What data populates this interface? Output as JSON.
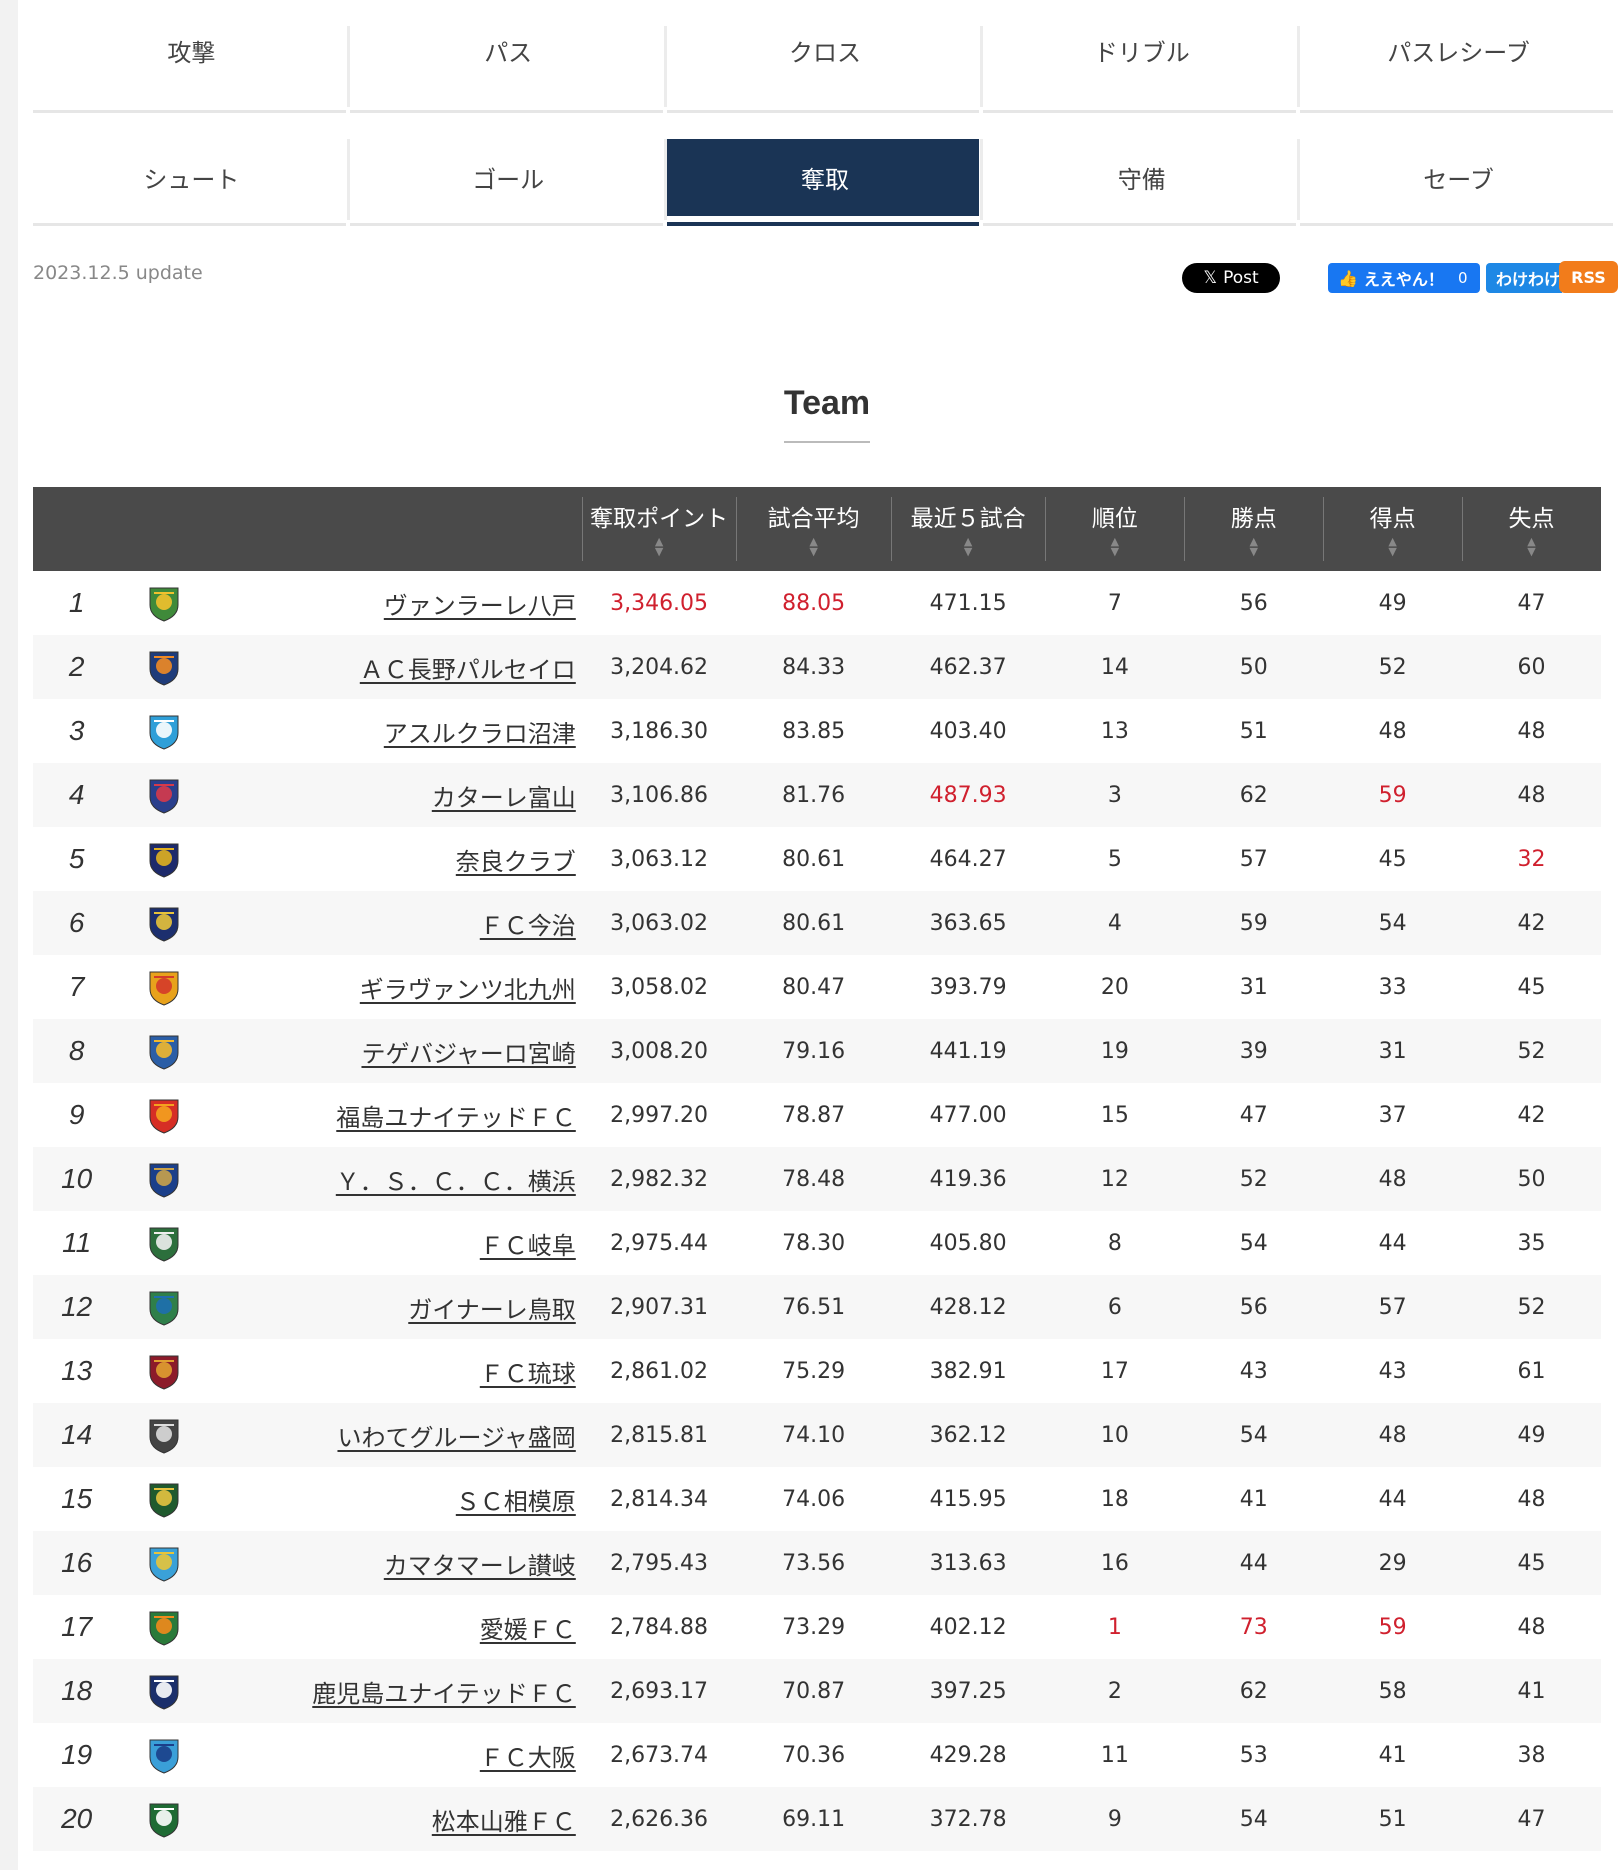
{
  "tabs_row1": [
    "攻撃",
    "パス",
    "クロス",
    "ドリブル",
    "パスレシーブ"
  ],
  "tabs_row2": [
    "シュート",
    "ゴール",
    "奪取",
    "守備",
    "セーブ"
  ],
  "active_tab": "奪取",
  "update_text": "2023.12.5 update",
  "share": {
    "x_label": "Post",
    "fb_label": "ええやん！",
    "fb_count": "0",
    "hatena_label": "わけわけ",
    "rss_label": "RSS"
  },
  "section_title": "Team",
  "table": {
    "headers": [
      "奪取ポイント",
      "試合平均",
      "最近５試合",
      "順位",
      "勝点",
      "得点",
      "失点"
    ],
    "rows": [
      {
        "rank": "1",
        "team": "ヴァンラーレ八戸",
        "points": "3,346.05",
        "avg": "88.05",
        "last5": "471.15",
        "pos": "7",
        "pts": "56",
        "gf": "49",
        "ga": "47",
        "crest_color": "#3f8a3a",
        "crest_accent": "#f2c12e"
      },
      {
        "rank": "2",
        "team": "ＡＣ長野パルセイロ",
        "points": "3,204.62",
        "avg": "84.33",
        "last5": "462.37",
        "pos": "14",
        "pts": "50",
        "gf": "52",
        "ga": "60",
        "crest_color": "#1f3c7a",
        "crest_accent": "#f08a24"
      },
      {
        "rank": "3",
        "team": "アスルクラロ沼津",
        "points": "3,186.30",
        "avg": "83.85",
        "last5": "403.40",
        "pos": "13",
        "pts": "51",
        "gf": "48",
        "ga": "48",
        "crest_color": "#2f9fd8",
        "crest_accent": "#ffffff"
      },
      {
        "rank": "4",
        "team": "カターレ富山",
        "points": "3,106.86",
        "avg": "81.76",
        "last5": "487.93",
        "pos": "3",
        "pts": "62",
        "gf": "59",
        "ga": "48",
        "crest_color": "#2a3f8c",
        "crest_accent": "#d63a4a"
      },
      {
        "rank": "5",
        "team": "奈良クラブ",
        "points": "3,063.12",
        "avg": "80.61",
        "last5": "464.27",
        "pos": "5",
        "pts": "57",
        "gf": "45",
        "ga": "32",
        "crest_color": "#1d2a6b",
        "crest_accent": "#e0b020"
      },
      {
        "rank": "6",
        "team": "ＦＣ今治",
        "points": "3,063.02",
        "avg": "80.61",
        "last5": "363.65",
        "pos": "4",
        "pts": "59",
        "gf": "54",
        "ga": "42",
        "crest_color": "#1c2f6e",
        "crest_accent": "#e8c33a"
      },
      {
        "rank": "7",
        "team": "ギラヴァンツ北九州",
        "points": "3,058.02",
        "avg": "80.47",
        "last5": "393.79",
        "pos": "20",
        "pts": "31",
        "gf": "33",
        "ga": "45",
        "crest_color": "#e8a21c",
        "crest_accent": "#d43a2a"
      },
      {
        "rank": "8",
        "team": "テゲバジャーロ宮崎",
        "points": "3,008.20",
        "avg": "79.16",
        "last5": "441.19",
        "pos": "19",
        "pts": "39",
        "gf": "31",
        "ga": "52",
        "crest_color": "#2b5ea6",
        "crest_accent": "#f1b82d"
      },
      {
        "rank": "9",
        "team": "福島ユナイテッドＦＣ",
        "points": "2,997.20",
        "avg": "78.87",
        "last5": "477.00",
        "pos": "15",
        "pts": "47",
        "gf": "37",
        "ga": "42",
        "crest_color": "#d62e25",
        "crest_accent": "#f4a21f"
      },
      {
        "rank": "10",
        "team": "Ｙ．Ｓ．Ｃ．Ｃ．横浜",
        "points": "2,982.32",
        "avg": "78.48",
        "last5": "419.36",
        "pos": "12",
        "pts": "52",
        "gf": "48",
        "ga": "50",
        "crest_color": "#1b3f8a",
        "crest_accent": "#c9a24a"
      },
      {
        "rank": "11",
        "team": "ＦＣ岐阜",
        "points": "2,975.44",
        "avg": "78.30",
        "last5": "405.80",
        "pos": "8",
        "pts": "54",
        "gf": "44",
        "ga": "35",
        "crest_color": "#2c6f3c",
        "crest_accent": "#eeeeee"
      },
      {
        "rank": "12",
        "team": "ガイナーレ鳥取",
        "points": "2,907.31",
        "avg": "76.51",
        "last5": "428.12",
        "pos": "6",
        "pts": "56",
        "gf": "57",
        "ga": "52",
        "crest_color": "#2f7f4a",
        "crest_accent": "#1e6fb0"
      },
      {
        "rank": "13",
        "team": "ＦＣ琉球",
        "points": "2,861.02",
        "avg": "75.29",
        "last5": "382.91",
        "pos": "17",
        "pts": "43",
        "gf": "43",
        "ga": "61",
        "crest_color": "#8c1b2a",
        "crest_accent": "#e0a030"
      },
      {
        "rank": "14",
        "team": "いわてグルージャ盛岡",
        "points": "2,815.81",
        "avg": "74.10",
        "last5": "362.12",
        "pos": "10",
        "pts": "54",
        "gf": "48",
        "ga": "49",
        "crest_color": "#444444",
        "crest_accent": "#dddddd"
      },
      {
        "rank": "15",
        "team": "ＳＣ相模原",
        "points": "2,814.34",
        "avg": "74.06",
        "last5": "415.95",
        "pos": "18",
        "pts": "41",
        "gf": "44",
        "ga": "48",
        "crest_color": "#1f5a2e",
        "crest_accent": "#e6c340"
      },
      {
        "rank": "16",
        "team": "カマタマーレ讃岐",
        "points": "2,795.43",
        "avg": "73.56",
        "last5": "313.63",
        "pos": "16",
        "pts": "44",
        "gf": "29",
        "ga": "45",
        "crest_color": "#3aa1d8",
        "crest_accent": "#e8c43a"
      },
      {
        "rank": "17",
        "team": "愛媛ＦＣ",
        "points": "2,784.88",
        "avg": "73.29",
        "last5": "402.12",
        "pos": "1",
        "pts": "73",
        "gf": "59",
        "ga": "48",
        "crest_color": "#2a7a3a",
        "crest_accent": "#f28a1c"
      },
      {
        "rank": "18",
        "team": "鹿児島ユナイテッドＦＣ",
        "points": "2,693.17",
        "avg": "70.87",
        "last5": "397.25",
        "pos": "2",
        "pts": "62",
        "gf": "58",
        "ga": "41",
        "crest_color": "#1b2f6b",
        "crest_accent": "#ffffff"
      },
      {
        "rank": "19",
        "team": "ＦＣ大阪",
        "points": "2,673.74",
        "avg": "70.36",
        "last5": "429.28",
        "pos": "11",
        "pts": "53",
        "gf": "41",
        "ga": "38",
        "crest_color": "#3a9fd8",
        "crest_accent": "#1b3f8a"
      },
      {
        "rank": "20",
        "team": "松本山雅ＦＣ",
        "points": "2,626.36",
        "avg": "69.11",
        "last5": "372.78",
        "pos": "9",
        "pts": "54",
        "gf": "51",
        "ga": "47",
        "crest_color": "#1f6b34",
        "crest_accent": "#ffffff"
      }
    ],
    "highlighted": [
      {
        "row": 0,
        "col": "points"
      },
      {
        "row": 0,
        "col": "avg"
      },
      {
        "row": 3,
        "col": "last5"
      },
      {
        "row": 3,
        "col": "gf"
      },
      {
        "row": 4,
        "col": "ga"
      },
      {
        "row": 16,
        "col": "pos"
      },
      {
        "row": 16,
        "col": "pts"
      },
      {
        "row": 16,
        "col": "gf"
      }
    ],
    "highlight_color": "#d0202e"
  }
}
